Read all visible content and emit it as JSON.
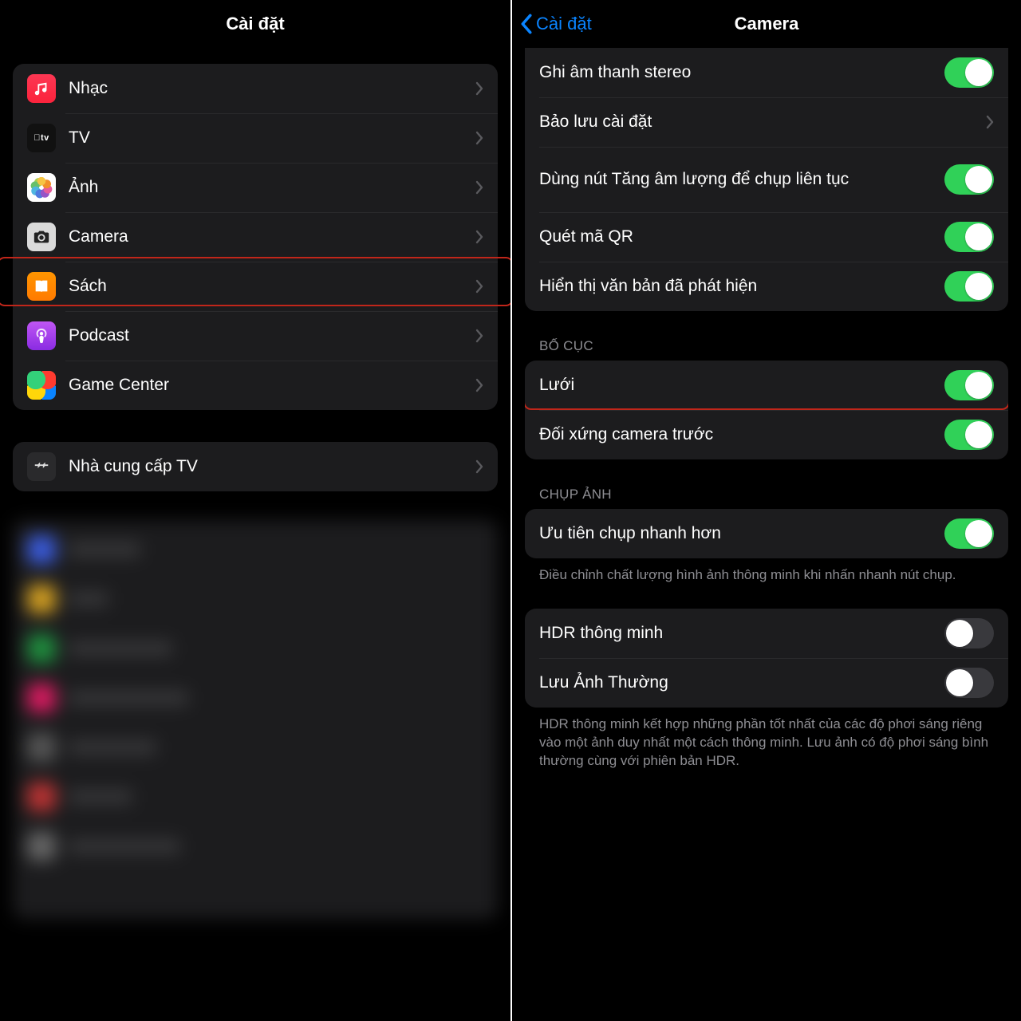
{
  "left": {
    "title": "Cài đặt",
    "items": [
      {
        "label": "Nhạc"
      },
      {
        "label": "TV"
      },
      {
        "label": "Ảnh"
      },
      {
        "label": "Camera"
      },
      {
        "label": "Sách"
      },
      {
        "label": "Podcast"
      },
      {
        "label": "Game Center"
      }
    ],
    "tv_provider": "Nhà cung cấp TV"
  },
  "right": {
    "back": "Cài đặt",
    "title": "Camera",
    "group1": [
      {
        "label": "Ghi âm thanh stereo",
        "type": "toggle",
        "on": true
      },
      {
        "label": "Bảo lưu cài đặt",
        "type": "link"
      },
      {
        "label": "Dùng nút Tăng âm lượng để chụp liên tục",
        "type": "toggle",
        "on": true
      },
      {
        "label": "Quét mã QR",
        "type": "toggle",
        "on": true
      },
      {
        "label": "Hiển thị văn bản đã phát hiện",
        "type": "toggle",
        "on": true
      }
    ],
    "sec_layout": "BỐ CỤC",
    "group2": [
      {
        "label": "Lưới",
        "type": "toggle",
        "on": true
      },
      {
        "label": "Đối xứng camera trước",
        "type": "toggle",
        "on": true
      }
    ],
    "sec_capture": "CHỤP ẢNH",
    "group3": [
      {
        "label": "Ưu tiên chụp nhanh hơn",
        "type": "toggle",
        "on": true
      }
    ],
    "footer_capture": "Điều chỉnh chất lượng hình ảnh thông minh khi nhấn nhanh nút chụp.",
    "group4": [
      {
        "label": "HDR thông minh",
        "type": "toggle",
        "on": false
      },
      {
        "label": "Lưu Ảnh Thường",
        "type": "toggle",
        "on": false
      }
    ],
    "footer_hdr": "HDR thông minh kết hợp những phần tốt nhất của các độ phơi sáng riêng vào một ảnh duy nhất một cách thông minh. Lưu ảnh có độ phơi sáng bình thường cùng với phiên bản HDR."
  }
}
